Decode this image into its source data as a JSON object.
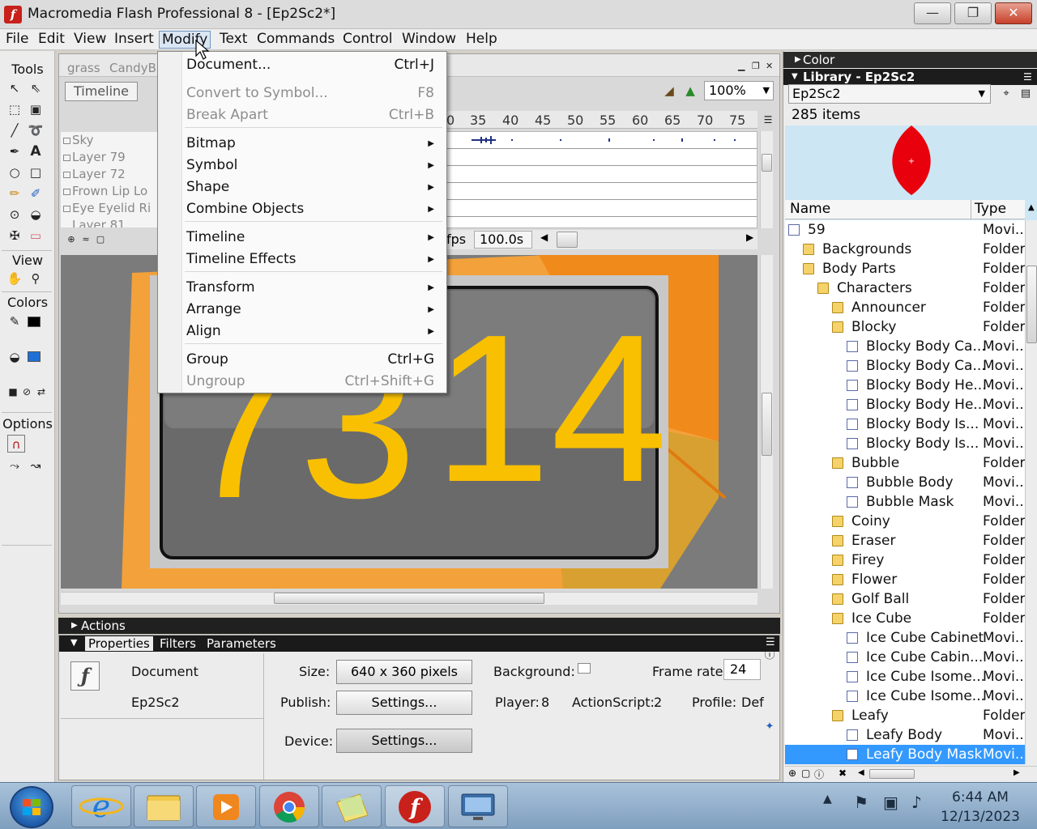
{
  "window": {
    "title": "Macromedia Flash Professional 8 - [Ep2Sc2*]",
    "logo": "f",
    "minimize": "—",
    "maximize": "❐",
    "close": "✕"
  },
  "menubar": [
    "File",
    "Edit",
    "View",
    "Insert",
    "Modify",
    "Text",
    "Commands",
    "Control",
    "Window",
    "Help"
  ],
  "tools": {
    "tools_label": "Tools",
    "view_label": "View",
    "colors_label": "Colors",
    "options_label": "Options",
    "stroke_color": "#000000",
    "fill_color": "#1f6fd6"
  },
  "document": {
    "tabs": [
      "grass",
      "CandyBa"
    ],
    "timeline_button": "Timeline",
    "zoom": "100%",
    "layers": [
      "Sky",
      "Layer 79",
      "Layer 72",
      "Frown Lip Lo",
      "Eye Eyelid Ri",
      "Layer 81"
    ],
    "ruler_ticks": [
      "0",
      "35",
      "40",
      "45",
      "50",
      "55",
      "60",
      "65",
      "70",
      "75"
    ],
    "fps_suffix": "fps",
    "elapsed_time": "100.0s",
    "stage_text_left": "73",
    "stage_text_right": "14"
  },
  "modify_menu": {
    "items": [
      {
        "label": "Document...",
        "shortcut": "Ctrl+J",
        "enabled": true,
        "submenu": false
      },
      {
        "label": "Convert to Symbol...",
        "shortcut": "F8",
        "enabled": false,
        "submenu": false
      },
      {
        "label": "Break Apart",
        "shortcut": "Ctrl+B",
        "enabled": false,
        "submenu": false
      },
      {
        "label": "Bitmap",
        "shortcut": "",
        "enabled": true,
        "submenu": true
      },
      {
        "label": "Symbol",
        "shortcut": "",
        "enabled": true,
        "submenu": true
      },
      {
        "label": "Shape",
        "shortcut": "",
        "enabled": true,
        "submenu": true
      },
      {
        "label": "Combine Objects",
        "shortcut": "",
        "enabled": true,
        "submenu": true
      },
      {
        "label": "Timeline",
        "shortcut": "",
        "enabled": true,
        "submenu": true
      },
      {
        "label": "Timeline Effects",
        "shortcut": "",
        "enabled": true,
        "submenu": true
      },
      {
        "label": "Transform",
        "shortcut": "",
        "enabled": true,
        "submenu": true
      },
      {
        "label": "Arrange",
        "shortcut": "",
        "enabled": true,
        "submenu": true
      },
      {
        "label": "Align",
        "shortcut": "",
        "enabled": true,
        "submenu": true
      },
      {
        "label": "Group",
        "shortcut": "Ctrl+G",
        "enabled": true,
        "submenu": false
      },
      {
        "label": "Ungroup",
        "shortcut": "Ctrl+Shift+G",
        "enabled": false,
        "submenu": false
      }
    ]
  },
  "panels": {
    "actions_label": "Actions",
    "tabs": [
      "Properties",
      "Filters",
      "Parameters"
    ]
  },
  "properties": {
    "kind": "Document",
    "name": "Ep2Sc2",
    "size_label": "Size:",
    "size_value": "640 x 360 pixels",
    "publish_label": "Publish:",
    "settings_button": "Settings...",
    "background_label": "Background:",
    "frame_rate_label": "Frame rate:",
    "frame_rate_value": "24",
    "player_label": "Player:",
    "player_value": "8",
    "actionscript_label": "ActionScript:",
    "actionscript_value": "2",
    "profile_label": "Profile:",
    "profile_value": "Def",
    "device_label": "Device:",
    "device_settings_button": "Settings..."
  },
  "color_panel": {
    "label": "Color"
  },
  "library": {
    "header": "Library - Ep2Sc2",
    "selected_library": "Ep2Sc2",
    "count": "285 items",
    "col_name": "Name",
    "col_type": "Type",
    "items": [
      {
        "name": "59",
        "type": "Movi...",
        "indent": 0,
        "icon": "movie",
        "selected": false
      },
      {
        "name": "Backgrounds",
        "type": "Folder",
        "indent": 1,
        "icon": "folder",
        "selected": false
      },
      {
        "name": "Body Parts",
        "type": "Folder",
        "indent": 1,
        "icon": "folder",
        "selected": false
      },
      {
        "name": "Characters",
        "type": "Folder",
        "indent": 2,
        "icon": "folder",
        "selected": false
      },
      {
        "name": "Announcer",
        "type": "Folder",
        "indent": 3,
        "icon": "folder",
        "selected": false
      },
      {
        "name": "Blocky",
        "type": "Folder",
        "indent": 3,
        "icon": "folder",
        "selected": false
      },
      {
        "name": "Blocky Body Ca...",
        "type": "Movi...",
        "indent": 4,
        "icon": "movie",
        "selected": false
      },
      {
        "name": "Blocky Body Ca...",
        "type": "Movi...",
        "indent": 4,
        "icon": "movie",
        "selected": false
      },
      {
        "name": "Blocky Body He...",
        "type": "Movi...",
        "indent": 4,
        "icon": "movie",
        "selected": false
      },
      {
        "name": "Blocky Body He...",
        "type": "Movi...",
        "indent": 4,
        "icon": "movie",
        "selected": false
      },
      {
        "name": "Blocky Body Is...",
        "type": "Movi...",
        "indent": 4,
        "icon": "movie",
        "selected": false
      },
      {
        "name": "Blocky Body Is...",
        "type": "Movi...",
        "indent": 4,
        "icon": "movie",
        "selected": false
      },
      {
        "name": "Bubble",
        "type": "Folder",
        "indent": 3,
        "icon": "folder",
        "selected": false
      },
      {
        "name": "Bubble Body",
        "type": "Movi...",
        "indent": 4,
        "icon": "movie",
        "selected": false
      },
      {
        "name": "Bubble Mask",
        "type": "Movi...",
        "indent": 4,
        "icon": "movie",
        "selected": false
      },
      {
        "name": "Coiny",
        "type": "Folder",
        "indent": 3,
        "icon": "folder",
        "selected": false
      },
      {
        "name": "Eraser",
        "type": "Folder",
        "indent": 3,
        "icon": "folder",
        "selected": false
      },
      {
        "name": "Firey",
        "type": "Folder",
        "indent": 3,
        "icon": "folder",
        "selected": false
      },
      {
        "name": "Flower",
        "type": "Folder",
        "indent": 3,
        "icon": "folder",
        "selected": false
      },
      {
        "name": "Golf Ball",
        "type": "Folder",
        "indent": 3,
        "icon": "folder",
        "selected": false
      },
      {
        "name": "Ice Cube",
        "type": "Folder",
        "indent": 3,
        "icon": "folder",
        "selected": false
      },
      {
        "name": "Ice Cube Cabinet",
        "type": "Movi...",
        "indent": 4,
        "icon": "movie",
        "selected": false
      },
      {
        "name": "Ice Cube Cabin...",
        "type": "Movi...",
        "indent": 4,
        "icon": "movie",
        "selected": false
      },
      {
        "name": "Ice Cube Isome...",
        "type": "Movi...",
        "indent": 4,
        "icon": "movie",
        "selected": false
      },
      {
        "name": "Ice Cube Isome...",
        "type": "Movi...",
        "indent": 4,
        "icon": "movie",
        "selected": false
      },
      {
        "name": "Leafy",
        "type": "Folder",
        "indent": 3,
        "icon": "folder",
        "selected": false
      },
      {
        "name": "Leafy Body",
        "type": "Movi...",
        "indent": 4,
        "icon": "movie",
        "selected": false
      },
      {
        "name": "Leafy Body Mask",
        "type": "Movi...",
        "indent": 4,
        "icon": "movie",
        "selected": true
      }
    ]
  },
  "taskbar": {
    "time": "6:44 AM",
    "date": "12/13/2023",
    "apps": [
      "internet-explorer",
      "file-explorer",
      "media-player",
      "chrome",
      "sticky-notes",
      "flash",
      "remote-desktop"
    ]
  },
  "colors": {
    "selection": "#3399ff",
    "stage_orange": "#f3a13a",
    "stage_text": "#f8c000",
    "preview_bg": "#cce6f4",
    "preview_shape": "#e8000c"
  }
}
